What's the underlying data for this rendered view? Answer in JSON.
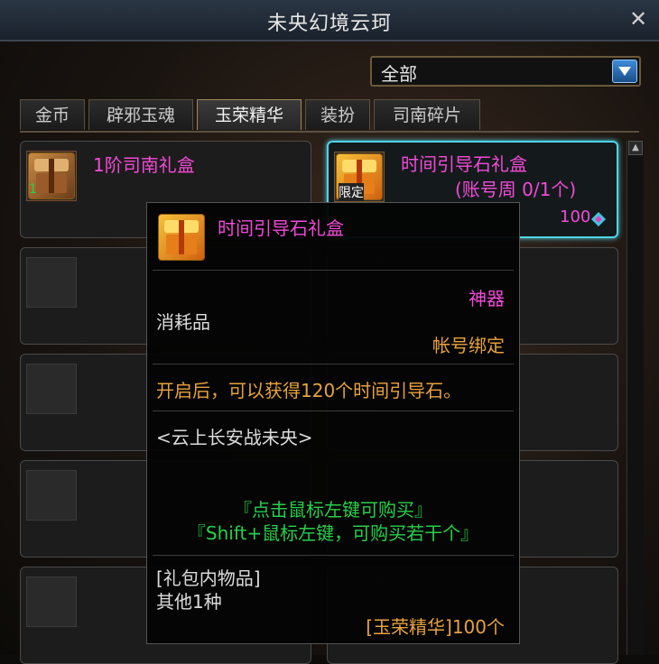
{
  "window": {
    "title": "未央幻境云珂",
    "close_glyph": "✕"
  },
  "filter": {
    "selected": "全部"
  },
  "tabs": [
    {
      "label": "金币",
      "active": false
    },
    {
      "label": "辟邪玉魂",
      "active": false
    },
    {
      "label": "玉荣精华",
      "active": true
    },
    {
      "label": "装扮",
      "active": false
    },
    {
      "label": "司南碎片",
      "active": false
    }
  ],
  "items": [
    {
      "name": "1阶司南礼盒",
      "count": "1"
    },
    {
      "name": "时间引导石礼盒",
      "limit": "(账号周 0/1个)",
      "limited_badge": "限定",
      "price": "100"
    }
  ],
  "tooltip": {
    "name": "时间引导石礼盒",
    "rarity": "神器",
    "category": "消耗品",
    "binding": "帐号绑定",
    "description": "开启后，可以获得120个时间引导石。",
    "series": "<云上长安战未央>",
    "hint1": "『点击鼠标左键可购买』",
    "hint2": "『Shift+鼠标左键，可购买若干个』",
    "contents_header": "[礼包内物品]",
    "contents": "其他1种",
    "cost": "[玉荣精华]100个"
  },
  "colors": {
    "rarity": "#f24ad6",
    "binding": "#e7a23c",
    "hint": "#27d04a",
    "selection": "#4fd4e8"
  }
}
